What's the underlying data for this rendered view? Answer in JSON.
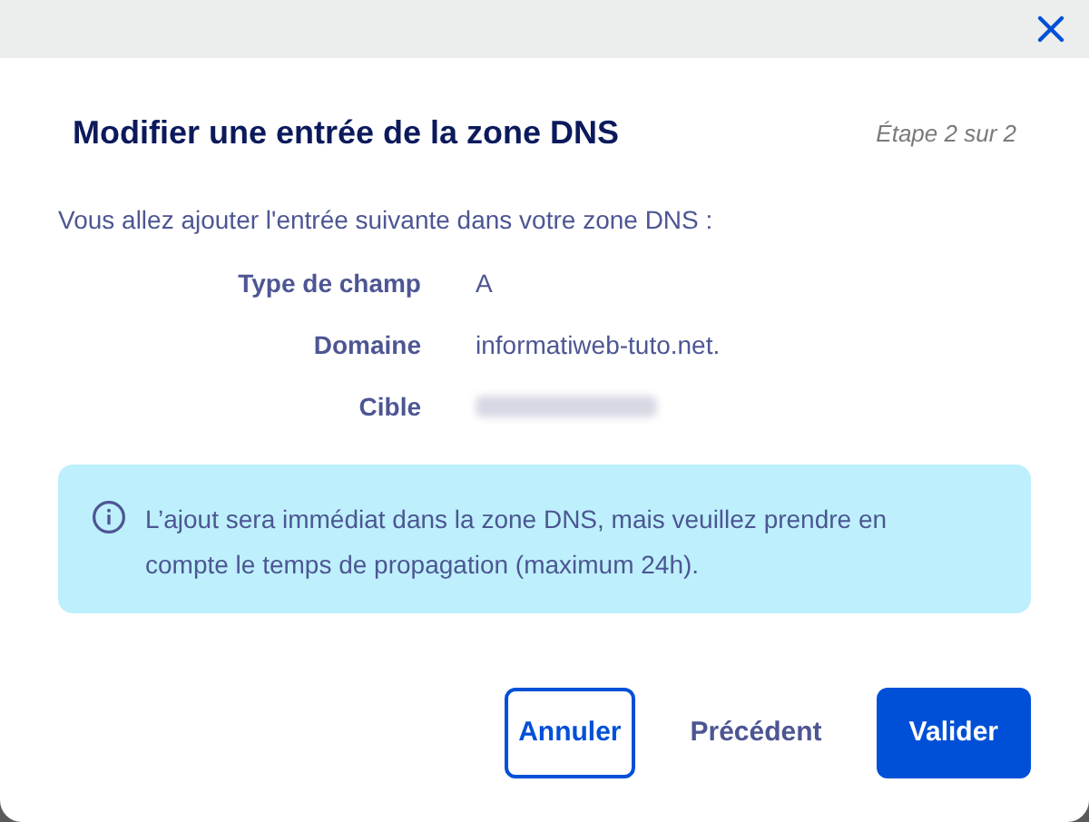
{
  "dialog": {
    "title": "Modifier une entrée de la zone DNS",
    "step": "Étape 2 sur 2",
    "intro": "Vous allez ajouter l'entrée suivante dans votre zone DNS :",
    "fields": [
      {
        "label": "Type de champ",
        "value": "A"
      },
      {
        "label": "Domaine",
        "value": "informatiweb-tuto.net."
      },
      {
        "label": "Cible",
        "kind": "blurred"
      }
    ],
    "notice": "L’ajout sera immédiat dans la zone DNS, mais veuillez prendre en compte le temps de propagation (maximum 24h).",
    "buttons": [
      {
        "label": "Annuler",
        "kind": "outline"
      },
      {
        "label": "Précédent",
        "kind": "text"
      },
      {
        "label": "Valider",
        "kind": "primary"
      }
    ]
  }
}
